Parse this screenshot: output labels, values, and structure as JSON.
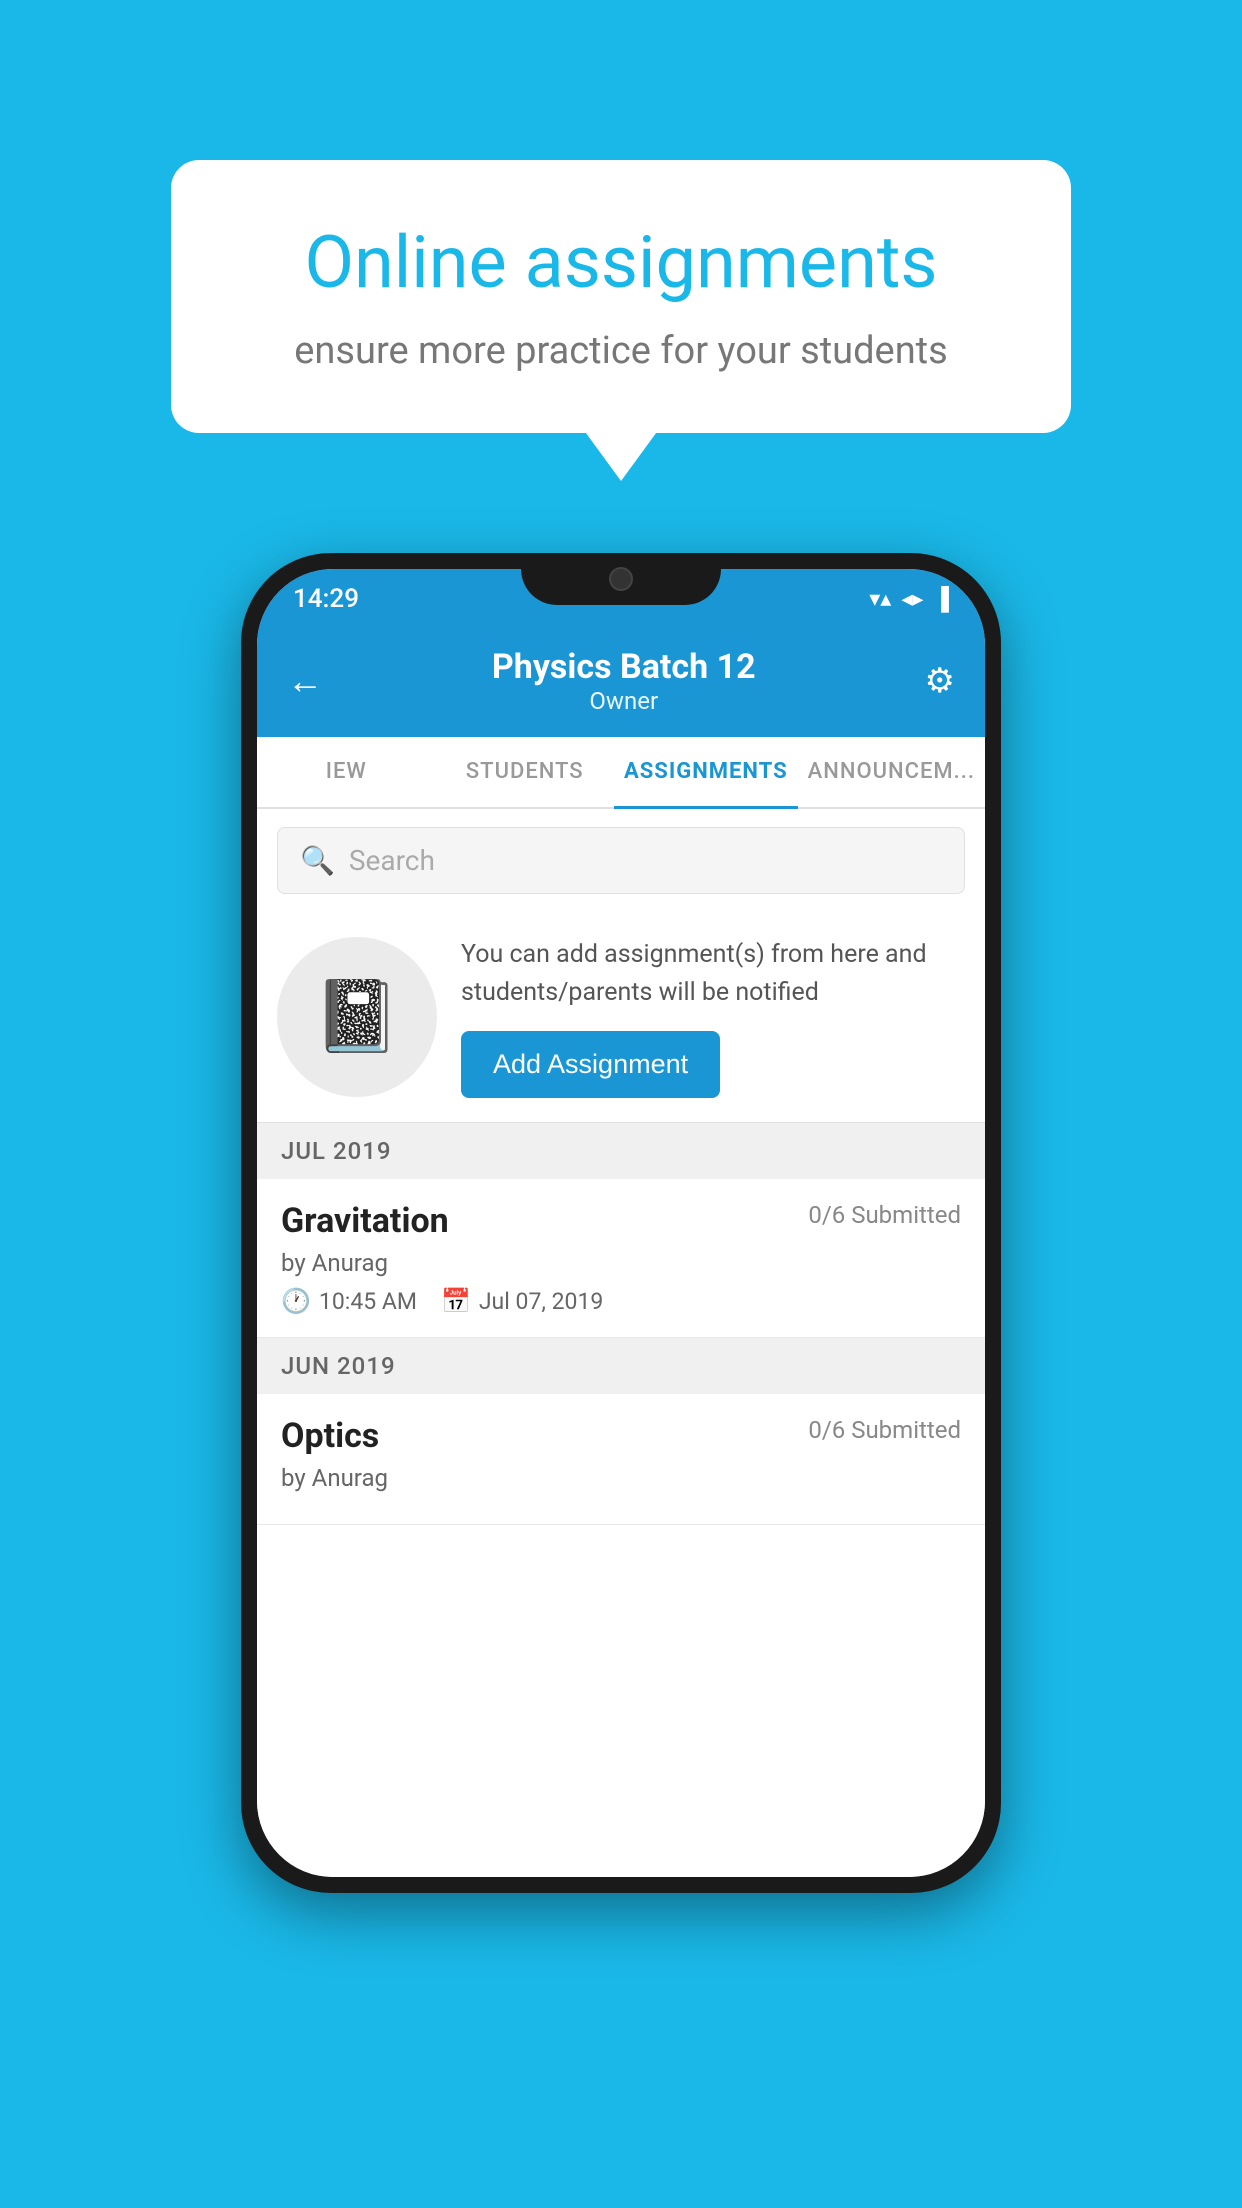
{
  "background_color": "#1ab8e8",
  "speech_bubble": {
    "title": "Online assignments",
    "subtitle": "ensure more practice for your students"
  },
  "phone": {
    "status_bar": {
      "time": "14:29",
      "wifi": "▼",
      "signal": "▲",
      "battery": "▐"
    },
    "header": {
      "title": "Physics Batch 12",
      "subtitle": "Owner",
      "back_label": "←",
      "settings_label": "⚙"
    },
    "tabs": [
      {
        "label": "IEW",
        "active": false
      },
      {
        "label": "STUDENTS",
        "active": false
      },
      {
        "label": "ASSIGNMENTS",
        "active": true
      },
      {
        "label": "ANNOUNCEM...",
        "active": false
      }
    ],
    "search": {
      "placeholder": "Search"
    },
    "promo": {
      "description": "You can add assignment(s) from here and students/parents will be notified",
      "button_label": "Add Assignment"
    },
    "sections": [
      {
        "label": "JUL 2019",
        "assignments": [
          {
            "name": "Gravitation",
            "submitted": "0/6 Submitted",
            "author": "by Anurag",
            "time": "10:45 AM",
            "date": "Jul 07, 2019"
          }
        ]
      },
      {
        "label": "JUN 2019",
        "assignments": [
          {
            "name": "Optics",
            "submitted": "0/6 Submitted",
            "author": "by Anurag",
            "time": "",
            "date": ""
          }
        ]
      }
    ]
  }
}
